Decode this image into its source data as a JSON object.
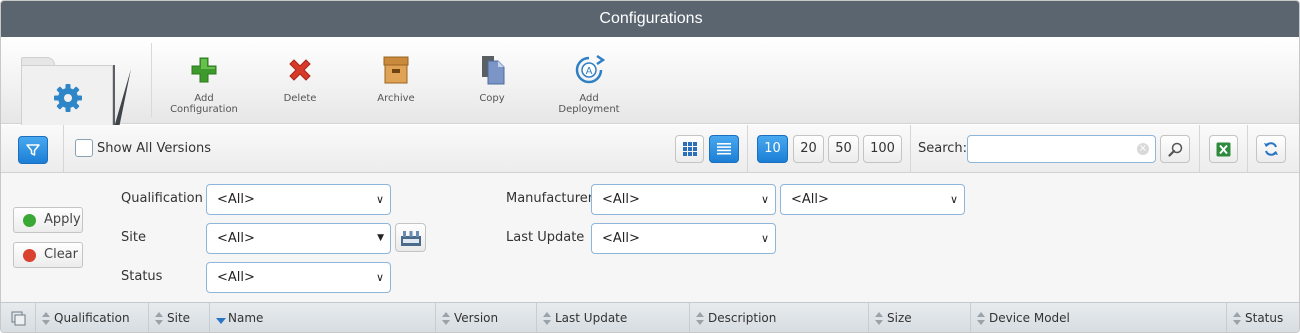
{
  "window": {
    "title": "Configurations"
  },
  "ribbon": {
    "buttons": [
      {
        "label": "Add\nConfiguration",
        "icon": "add-icon"
      },
      {
        "label": "Delete",
        "icon": "delete-icon"
      },
      {
        "label": "Archive",
        "icon": "archive-icon"
      },
      {
        "label": "Copy",
        "icon": "copy-icon"
      },
      {
        "label": "Add\nDeployment",
        "icon": "deployment-icon"
      }
    ]
  },
  "toolbar": {
    "show_all_versions_label": "Show All Versions",
    "show_all_versions_checked": false,
    "page_sizes": [
      "10",
      "20",
      "50",
      "100"
    ],
    "selected_page_size": "10",
    "search_label": "Search:",
    "search_value": "",
    "clear_glyph": "×"
  },
  "filters": {
    "apply_label": "Apply",
    "clear_label": "Clear",
    "qualification": {
      "label": "Qualification",
      "value": "<All>"
    },
    "site": {
      "label": "Site",
      "value": "<All>"
    },
    "status": {
      "label": "Status",
      "value": "<All>"
    },
    "manufacturer": {
      "label": "Manufacturer",
      "value": "<All>",
      "value2": "<All>"
    },
    "last_update": {
      "label": "Last Update",
      "value": "<All>"
    }
  },
  "grid": {
    "columns": [
      "Qualification",
      "Site",
      "Name",
      "Version",
      "Last Update",
      "Description",
      "Size",
      "Device Model",
      "Status"
    ],
    "sorted_column": "Name",
    "sort_direction": "descending"
  },
  "colors": {
    "title_bar": "#5b656f",
    "accent": "#1c7fd6",
    "apply": "#3aa835",
    "clear": "#d9422e"
  }
}
